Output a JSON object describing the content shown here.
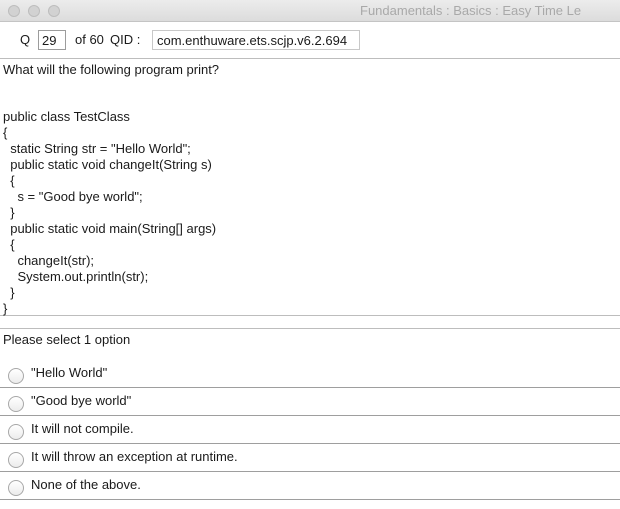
{
  "window": {
    "title": "Fundamentals : Basics :  Easy   Time Le"
  },
  "header": {
    "q_label": "Q",
    "question_number": "29",
    "of_label": "of 60",
    "qid_label": "QID :",
    "qid_value": "com.enthuware.ets.scjp.v6.2.694"
  },
  "question": {
    "text": "What will the following program print?",
    "code_lines": [
      "public class TestClass",
      "{",
      "  static String str = \"Hello World\";",
      "  public static void changeIt(String s)",
      "  {",
      "    s = \"Good bye world\";",
      "  }",
      "  public static void main(String[] args)",
      "  {",
      "    changeIt(str);",
      "    System.out.println(str);",
      "  }",
      "}"
    ]
  },
  "options": {
    "select_label": "Please select 1 option",
    "items": [
      {
        "label": "\"Hello World\""
      },
      {
        "label": "\"Good bye world\""
      },
      {
        "label": "It will not compile."
      },
      {
        "label": "It will throw an exception at runtime."
      },
      {
        "label": "None of the above."
      }
    ]
  }
}
